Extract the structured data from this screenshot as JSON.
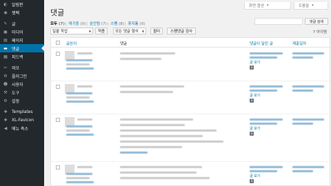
{
  "sidebar": {
    "items": [
      {
        "icon": "dashboard-icon",
        "glyph": "◐",
        "label": "알림판"
      },
      {
        "icon": "jetpack-icon",
        "glyph": "◉",
        "label": "젯팩"
      },
      {
        "icon": "pin-icon",
        "glyph": "✎",
        "label": "글"
      },
      {
        "icon": "media-icon",
        "glyph": "▣",
        "label": "미디어"
      },
      {
        "icon": "pages-icon",
        "glyph": "▤",
        "label": "페이지"
      },
      {
        "icon": "comments-icon",
        "glyph": "▬",
        "label": "댓글",
        "active": true
      },
      {
        "icon": "feedback-icon",
        "glyph": "▦",
        "label": "피드백"
      },
      {
        "icon": "appearance-icon",
        "glyph": "✂",
        "label": "외모"
      },
      {
        "icon": "plugins-icon",
        "glyph": "⚙",
        "label": "플러그인"
      },
      {
        "icon": "users-icon",
        "glyph": "☻",
        "label": "사용자"
      },
      {
        "icon": "tools-icon",
        "glyph": "⚒",
        "label": "도구"
      },
      {
        "icon": "settings-icon",
        "glyph": "⚙",
        "label": "설정"
      },
      {
        "icon": "templates-icon",
        "glyph": "✚",
        "label": "Templates"
      },
      {
        "icon": "favicon-icon",
        "glyph": "✚",
        "label": "XL-Favicon"
      },
      {
        "icon": "collapse-icon",
        "glyph": "◀",
        "label": "메뉴 축소"
      }
    ]
  },
  "header": {
    "screen_options": "화면 옵션",
    "help": "도움말",
    "title": "댓글"
  },
  "filters": {
    "all": "모두",
    "all_count": "(7)",
    "pending": "대기중",
    "pending_count": "(0)",
    "approved": "승인됨",
    "approved_count": "(7)",
    "spam": "스팸",
    "spam_count": "(8)",
    "trash": "휴지통",
    "trash_count": "(0)"
  },
  "search": {
    "button": "댓글 검색"
  },
  "toolbar": {
    "bulk": "일괄 작업",
    "apply": "적용",
    "type_filter": "모든 댓글 형식",
    "filter": "필터",
    "spam_check": "스팸댓글 검사",
    "count": "7 아이템"
  },
  "table": {
    "col_author": "글쓴이",
    "col_comment": "댓글",
    "col_response": "댓글이 달린 글",
    "col_date": "제출일자",
    "view_post": "글 보기",
    "rows": [
      {
        "bubble": "1"
      },
      {
        "bubble": "1"
      },
      {
        "bubble": "1"
      },
      {
        "bubble": "1"
      }
    ]
  }
}
